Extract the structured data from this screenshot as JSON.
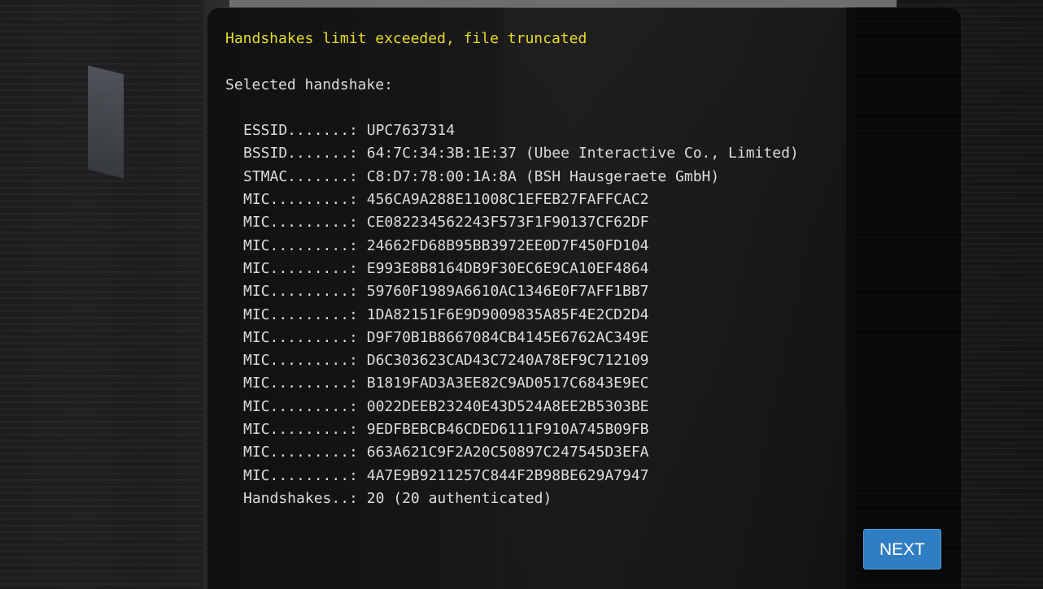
{
  "terminal": {
    "warning": "Handshakes limit exceeded, file truncated",
    "selected_heading": "Selected handshake:",
    "fields": [
      {
        "label": "ESSID.......:",
        "value": "UPC7637314"
      },
      {
        "label": "BSSID.......:",
        "value": "64:7C:34:3B:1E:37 (Ubee Interactive Co., Limited)"
      },
      {
        "label": "STMAC.......:",
        "value": "C8:D7:78:00:1A:8A (BSH Hausgeraete GmbH)"
      },
      {
        "label": "MIC.........:",
        "value": "456CA9A288E11008C1EFEB27FAFFCAC2"
      },
      {
        "label": "MIC.........:",
        "value": "CE08223456224 3F573F1F90137CF62DF"
      },
      {
        "label": "MIC.........:",
        "value": "24662FD68B95BB3972EE0D7F450FD104"
      },
      {
        "label": "MIC.........:",
        "value": "E993E8B8164DB9F30EC6E9CA10EF4864"
      },
      {
        "label": "MIC.........:",
        "value": "59760F1989A6610AC1346E0F7AFF1BB7"
      },
      {
        "label": "MIC.........:",
        "value": "1DA82151F6E9D9009835A85F4E2CD2D4"
      },
      {
        "label": "MIC.........:",
        "value": "D9F70B1B8667084CB4145E6762AC349E"
      },
      {
        "label": "MIC.........:",
        "value": "D6C303623CAD43C7240A78EF9C712109"
      },
      {
        "label": "MIC.........:",
        "value": "B1819FAD3A3EE82C9AD0517C6843E9EC"
      },
      {
        "label": "MIC.........:",
        "value": "0022DEEB23240E43D524A8EE2B5303BE"
      },
      {
        "label": "MIC.........:",
        "value": "9EDFBEBCB46CDED6111F910A745B09FB"
      },
      {
        "label": "MIC.........:",
        "value": "663A621C9F2A20C50897C247545D3EFA"
      },
      {
        "label": "MIC.........:",
        "value": "4A7E9B9211257C844F2B98BE629A7947"
      },
      {
        "label": "Handshakes..:",
        "value": "20 (20 authenticated)"
      }
    ]
  },
  "actions": {
    "next_label": "NEXT"
  },
  "colors": {
    "warning": "#e6dc2a",
    "text": "#dcdcdc",
    "button": "#2f7dc2"
  }
}
